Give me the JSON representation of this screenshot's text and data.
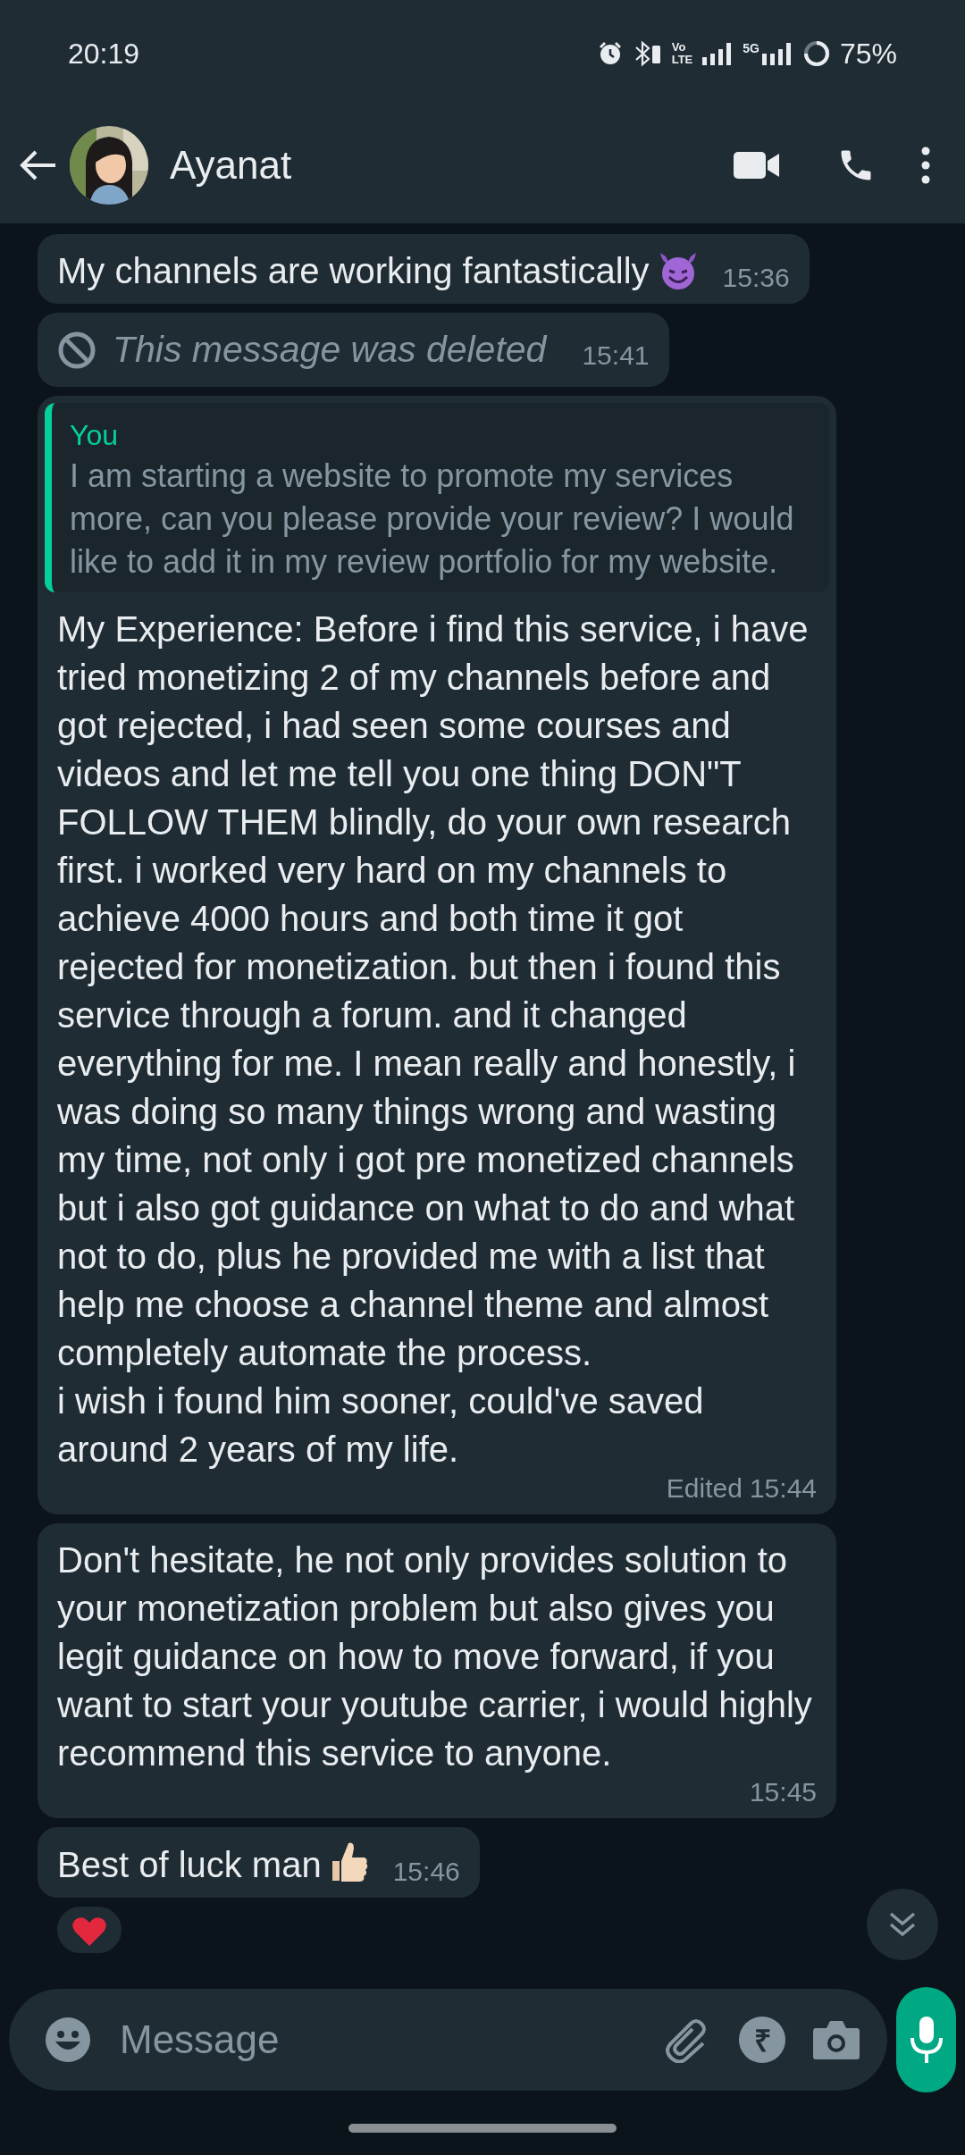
{
  "status_bar": {
    "time": "20:19",
    "volte_top": "Vo",
    "volte_bottom": "LTE",
    "network": "5G",
    "battery": "75%"
  },
  "header": {
    "contact_name": "Ayanat"
  },
  "messages": [
    {
      "kind": "text",
      "text": "My channels are working fantastically",
      "emoji": {
        "kind": "devil"
      },
      "time": "15:36"
    },
    {
      "kind": "deleted",
      "text": "This message was deleted",
      "time": "15:41"
    },
    {
      "kind": "reply",
      "quote_author": "You",
      "quote_text": "I am starting a website to promote my services more, can you please provide your review? I would like to add it in my review portfolio for my website.",
      "text": "My Experience: Before i find this service, i have tried monetizing 2 of my channels before and got rejected, i had seen some courses and videos and let me tell you one thing DON\"T FOLLOW THEM blindly, do your own research first. i worked very hard on my channels to achieve 4000 hours and both time it got rejected for monetization. but then i found this service through a forum. and it changed everything for me. I mean really and honestly, i was doing so many things wrong and wasting my time, not only i got pre monetized channels but i also got guidance on what to do and what not to do, plus he provided me with a list that help me choose a channel theme and almost completely automate the process.\ni wish i found him sooner, could've saved around 2 years of my life.",
      "edited_label": "Edited",
      "time": "15:44"
    },
    {
      "kind": "text",
      "text": "Don't hesitate, he not only provides solution to your monetization problem but also gives you legit guidance on how to move forward, if you want to start your youtube carrier, i would highly recommend this service to anyone.",
      "time": "15:45"
    },
    {
      "kind": "text",
      "text": "Best of luck man",
      "emoji": {
        "kind": "thumbs-up"
      },
      "time": "15:46",
      "reaction": {
        "kind": "heart"
      }
    }
  ],
  "composer": {
    "placeholder": "Message",
    "payment_symbol": "₹"
  }
}
